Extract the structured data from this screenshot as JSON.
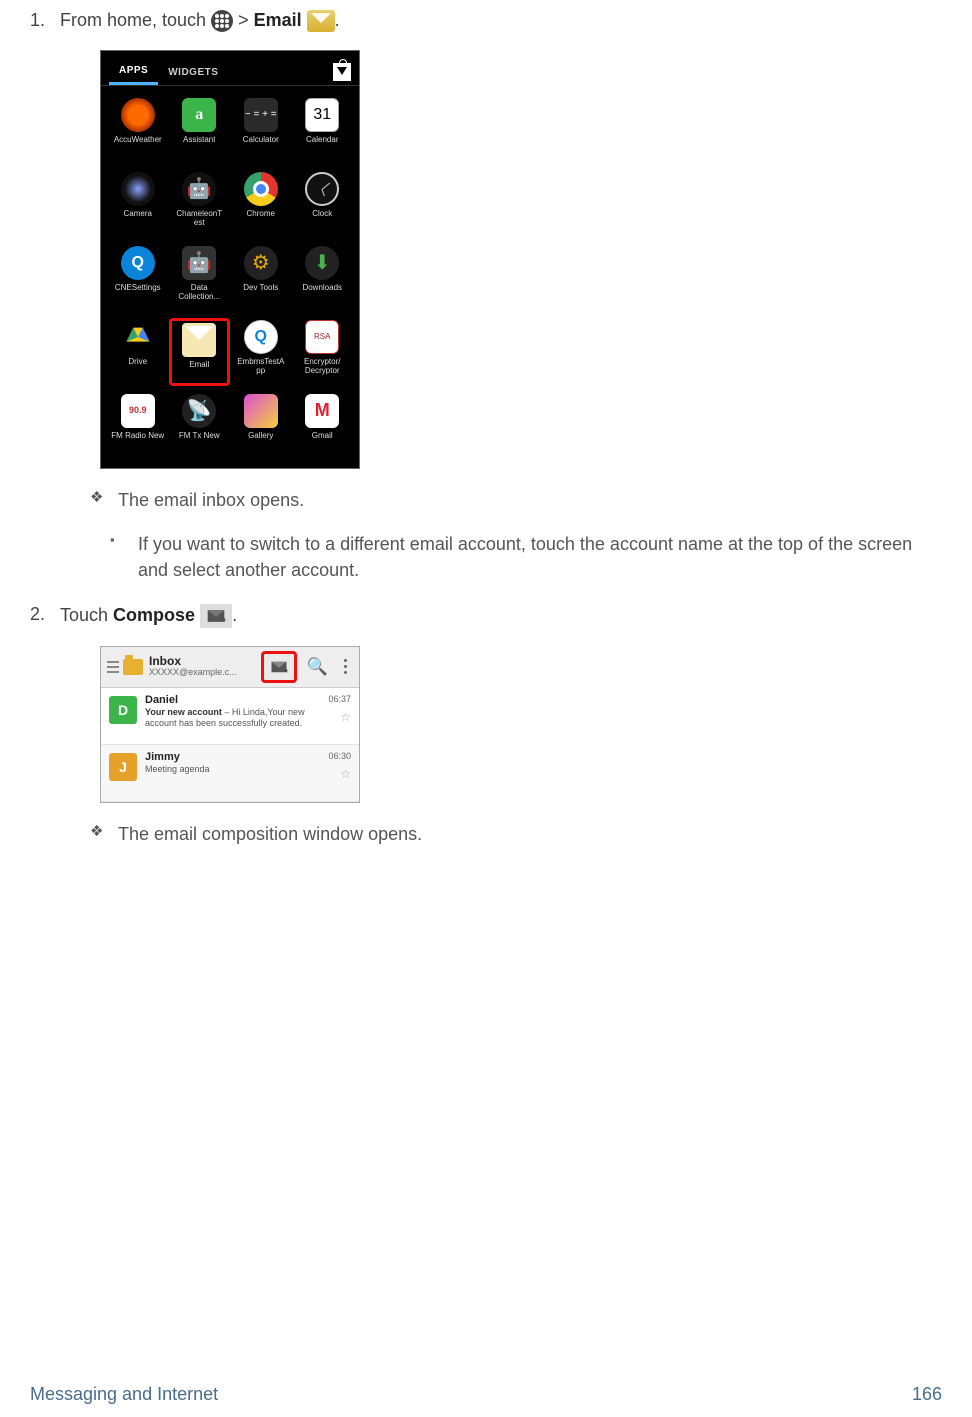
{
  "steps": {
    "one_prefix": "From home, touch ",
    "one_mid": " > ",
    "one_bold": "Email",
    "one_suffix": ".",
    "two_prefix": "Touch ",
    "two_bold": "Compose",
    "two_suffix": "."
  },
  "bullets": {
    "inbox_opens": "The email inbox opens.",
    "switch_account": "If you want to switch to a different email account, touch the account name at the top of the screen and select another account.",
    "compose_opens": "The email composition window opens."
  },
  "apps_tabs": {
    "apps": "APPS",
    "widgets": "WIDGETS"
  },
  "apps": [
    {
      "label": "AccuWeather"
    },
    {
      "label": "Assistant",
      "glyph": "a"
    },
    {
      "label": "Calculator",
      "glyph": "− =\n+ ="
    },
    {
      "label": "Calendar",
      "glyph": "31"
    },
    {
      "label": "Camera"
    },
    {
      "label": "ChameleonT est",
      "glyph": "🤖"
    },
    {
      "label": "Chrome"
    },
    {
      "label": "Clock"
    },
    {
      "label": "CNESettings",
      "glyph": "Q"
    },
    {
      "label": "Data Collection...",
      "glyph": "🤖"
    },
    {
      "label": "Dev Tools",
      "glyph": "⚙"
    },
    {
      "label": "Downloads",
      "glyph": "⬇"
    },
    {
      "label": "Drive",
      "glyph": "▲"
    },
    {
      "label": "Email"
    },
    {
      "label": "EmbmsTestA pp",
      "glyph": "Q"
    },
    {
      "label": "Encryptor/ Decryptor",
      "glyph": "RSA"
    },
    {
      "label": "FM Radio New",
      "glyph": "90.9"
    },
    {
      "label": "FM Tx New",
      "glyph": "📡"
    },
    {
      "label": "Gallery"
    },
    {
      "label": "Gmail",
      "glyph": "M"
    }
  ],
  "inbox": {
    "folder": "Inbox",
    "account": "XXXXX@example.c...",
    "mails": [
      {
        "initial": "D",
        "from": "Daniel",
        "subj": "Your new account",
        "preview": " – Hi Linda,Your new account has been successfully created.",
        "time": "06:37"
      },
      {
        "initial": "J",
        "from": "Jimmy",
        "subj": "Meeting agenda",
        "preview": "",
        "time": "06:30"
      }
    ]
  },
  "footer": {
    "section": "Messaging and Internet",
    "page": "166"
  }
}
